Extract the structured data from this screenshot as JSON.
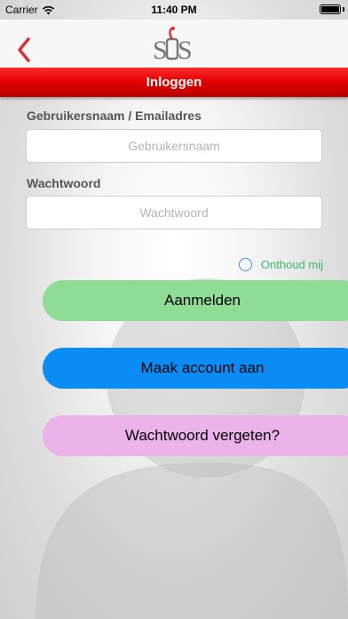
{
  "status_bar": {
    "carrier": "Carrier",
    "time": "11:40 PM"
  },
  "nav": {
    "back_icon": "chevron-left-icon",
    "logo_text": "SOS",
    "logo_icon": "sos-logo-icon"
  },
  "header": {
    "title": "Inloggen"
  },
  "form": {
    "username_label": "Gebruikersnaam / Emailadres",
    "username_placeholder": "Gebruikersnaam",
    "username_value": "",
    "password_label": "Wachtwoord",
    "password_placeholder": "Wachtwoord",
    "password_value": "",
    "remember_label": "Onthoud mij",
    "remember_checked": false
  },
  "buttons": {
    "login": "Aanmelden",
    "create_account": "Maak account aan",
    "forgot_password": "Wachtwoord vergeten?"
  },
  "colors": {
    "header_red": "#e00000",
    "login_green": "#8fdc97",
    "create_blue": "#0a8cf5",
    "forgot_pink": "#ecb3ea",
    "remember_green": "#3eb56a",
    "back_red": "#d9323a"
  }
}
